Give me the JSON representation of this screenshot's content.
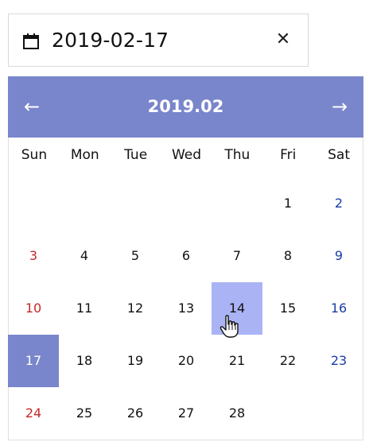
{
  "date_input": {
    "value": "2019-02-17",
    "clear_label": "✕",
    "calendar_icon": "calendar-icon"
  },
  "calendar": {
    "title": "2019.02",
    "prev_label": "←",
    "next_label": "→",
    "weekdays": [
      "Sun",
      "Mon",
      "Tue",
      "Wed",
      "Thu",
      "Fri",
      "Sat"
    ],
    "weeks": [
      [
        "",
        "",
        "",
        "",
        "",
        "1",
        "2"
      ],
      [
        "3",
        "4",
        "5",
        "6",
        "7",
        "8",
        "9"
      ],
      [
        "10",
        "11",
        "12",
        "13",
        "14",
        "15",
        "16"
      ],
      [
        "17",
        "18",
        "19",
        "20",
        "21",
        "22",
        "23"
      ],
      [
        "24",
        "25",
        "26",
        "27",
        "28",
        "",
        ""
      ]
    ],
    "selected_day": "17",
    "hovered_day": "14"
  },
  "colors": {
    "header": "#7986cb",
    "selected": "#7986cb",
    "hovered": "#aab4f5",
    "sunday": "#c62828",
    "saturday": "#1a3da8"
  }
}
